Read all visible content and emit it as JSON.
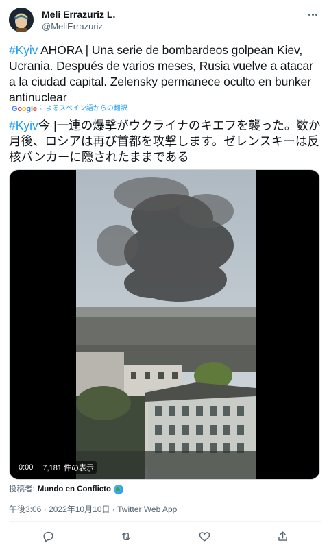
{
  "author": {
    "display_name": "Meli Errazuriz L.",
    "handle": "@MeliErrazuriz"
  },
  "tweet": {
    "hashtag": "#Kyiv",
    "text": " AHORA | Una serie de bombardeos golpean Kiev, Ucrania. Después de varios meses, Rusia vuelve a atacar a la ciudad capital. Zelensky permanece oculto en bunker antinuclear"
  },
  "translation": {
    "google_logo": "Google",
    "label": "によるスペイン語からの翻訳",
    "hashtag": "#Kyiv",
    "text": "今 |一連の爆撃がウクライナのキエフを襲った。数か月後、ロシアは再び首都を攻撃します。ゼレンスキーは反核バンカーに隠されたままである"
  },
  "video": {
    "time": "0:00",
    "views": "7,181 件の表示"
  },
  "poster": {
    "label": "投稿者:",
    "name": "Mundo en Conflicto"
  },
  "meta": {
    "time": "午後3:06",
    "date": "2022年10月10日",
    "separator": "·",
    "source": "Twitter Web App"
  },
  "icons": {
    "more": "more-icon",
    "reply": "reply-icon",
    "retweet": "retweet-icon",
    "like": "heart-icon",
    "share": "share-icon"
  },
  "colors": {
    "link": "#1d9bf0",
    "text": "#0f1419",
    "secondary": "#536471"
  }
}
